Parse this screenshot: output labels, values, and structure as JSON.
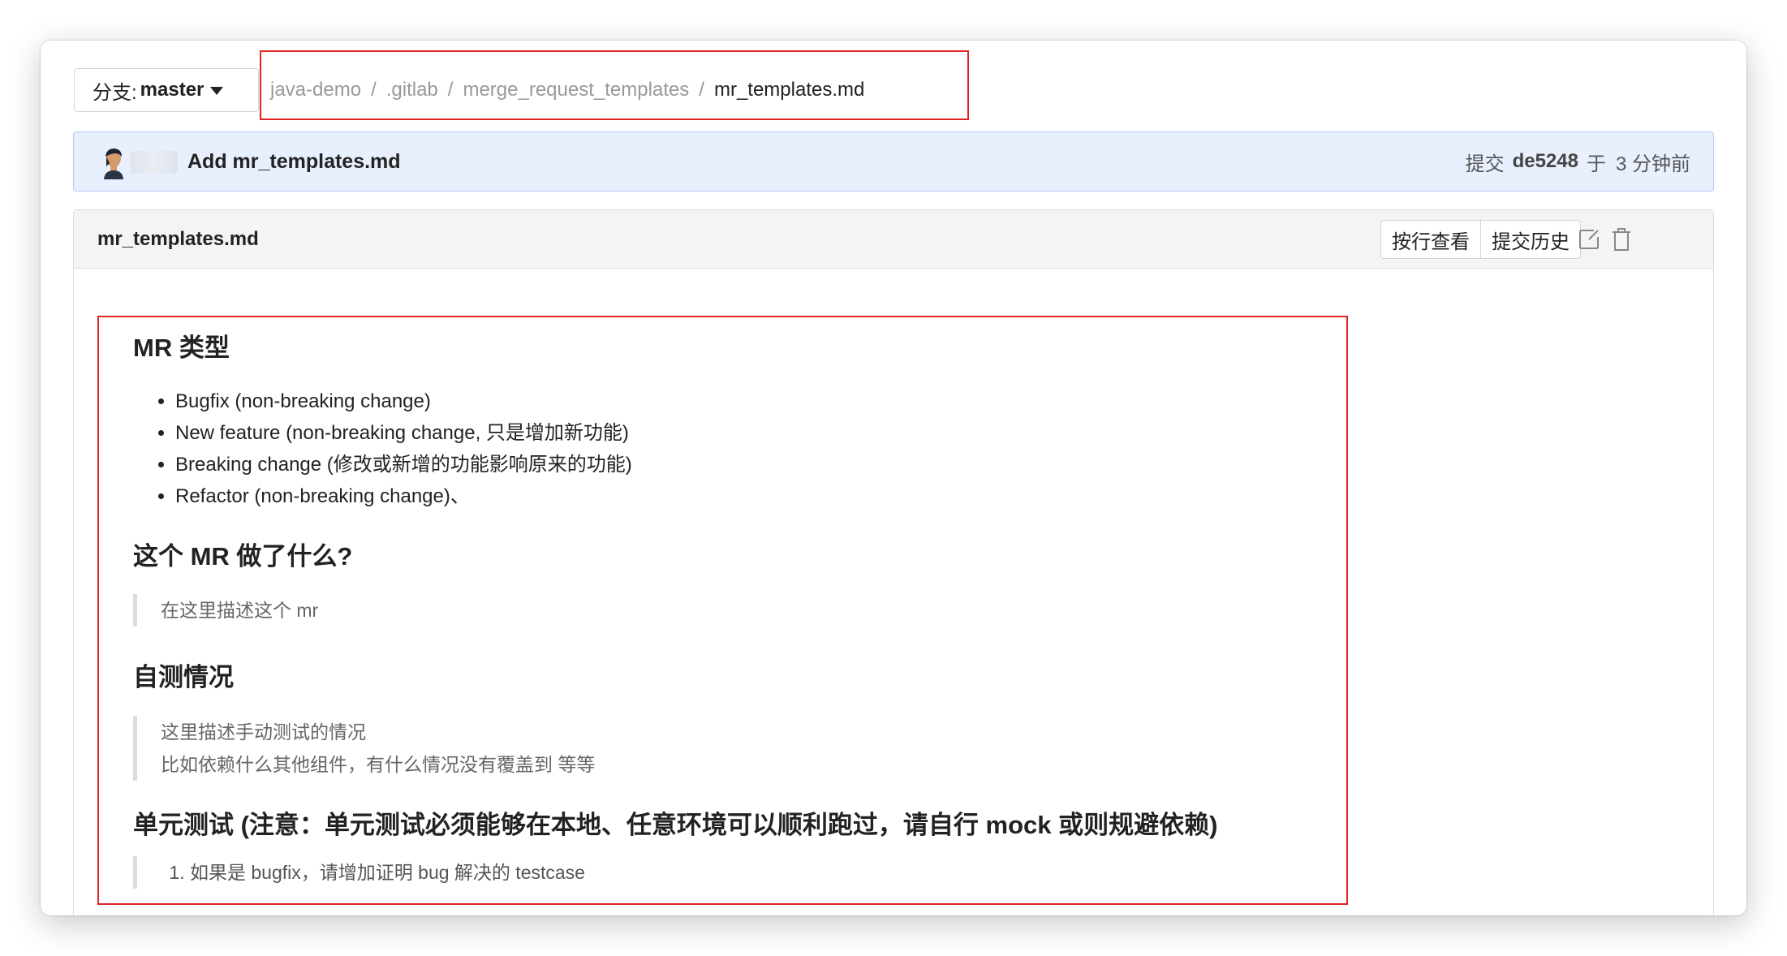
{
  "branch": {
    "label": "分支:",
    "value": "master"
  },
  "breadcrumb": [
    {
      "label": "java-demo"
    },
    {
      "label": ".gitlab"
    },
    {
      "label": "merge_request_templates"
    },
    {
      "label": "mr_templates.md"
    }
  ],
  "breadcrumb_separator": "/",
  "commit": {
    "message": "Add mr_templates.md",
    "meta_prefix": "提交",
    "sha": "de5248",
    "meta_mid": "于",
    "time": "3 分钟前"
  },
  "file": {
    "name": "mr_templates.md",
    "buttons": {
      "blame": "按行查看",
      "history": "提交历史"
    },
    "icons": {
      "edit": "edit-icon",
      "delete": "trash-icon"
    }
  },
  "content": {
    "h_type": "MR 类型",
    "type_items": [
      "Bugfix (non-breaking change)",
      "New feature (non-breaking change, 只是增加新功能)",
      "Breaking change (修改或新增的功能影响原来的功能)",
      "Refactor (non-breaking change)、"
    ],
    "h_what": "这个 MR 做了什么?",
    "what_quote": "在这里描述这个 mr",
    "h_selftest": "自测情况",
    "selftest_quote_1": "这里描述手动测试的情况",
    "selftest_quote_2": "比如依赖什么其他组件，有什么情况没有覆盖到 等等",
    "h_unittest": "单元测试 (注意：单元测试必须能够在本地、任意环境可以顺利跑过，请自行 mock 或则规避依赖)",
    "unittest_item_1": "如果是 bugfix，请增加证明 bug 解决的 testcase"
  },
  "colors": {
    "highlight_border": "#e02424",
    "commit_bg": "#e8effd"
  }
}
